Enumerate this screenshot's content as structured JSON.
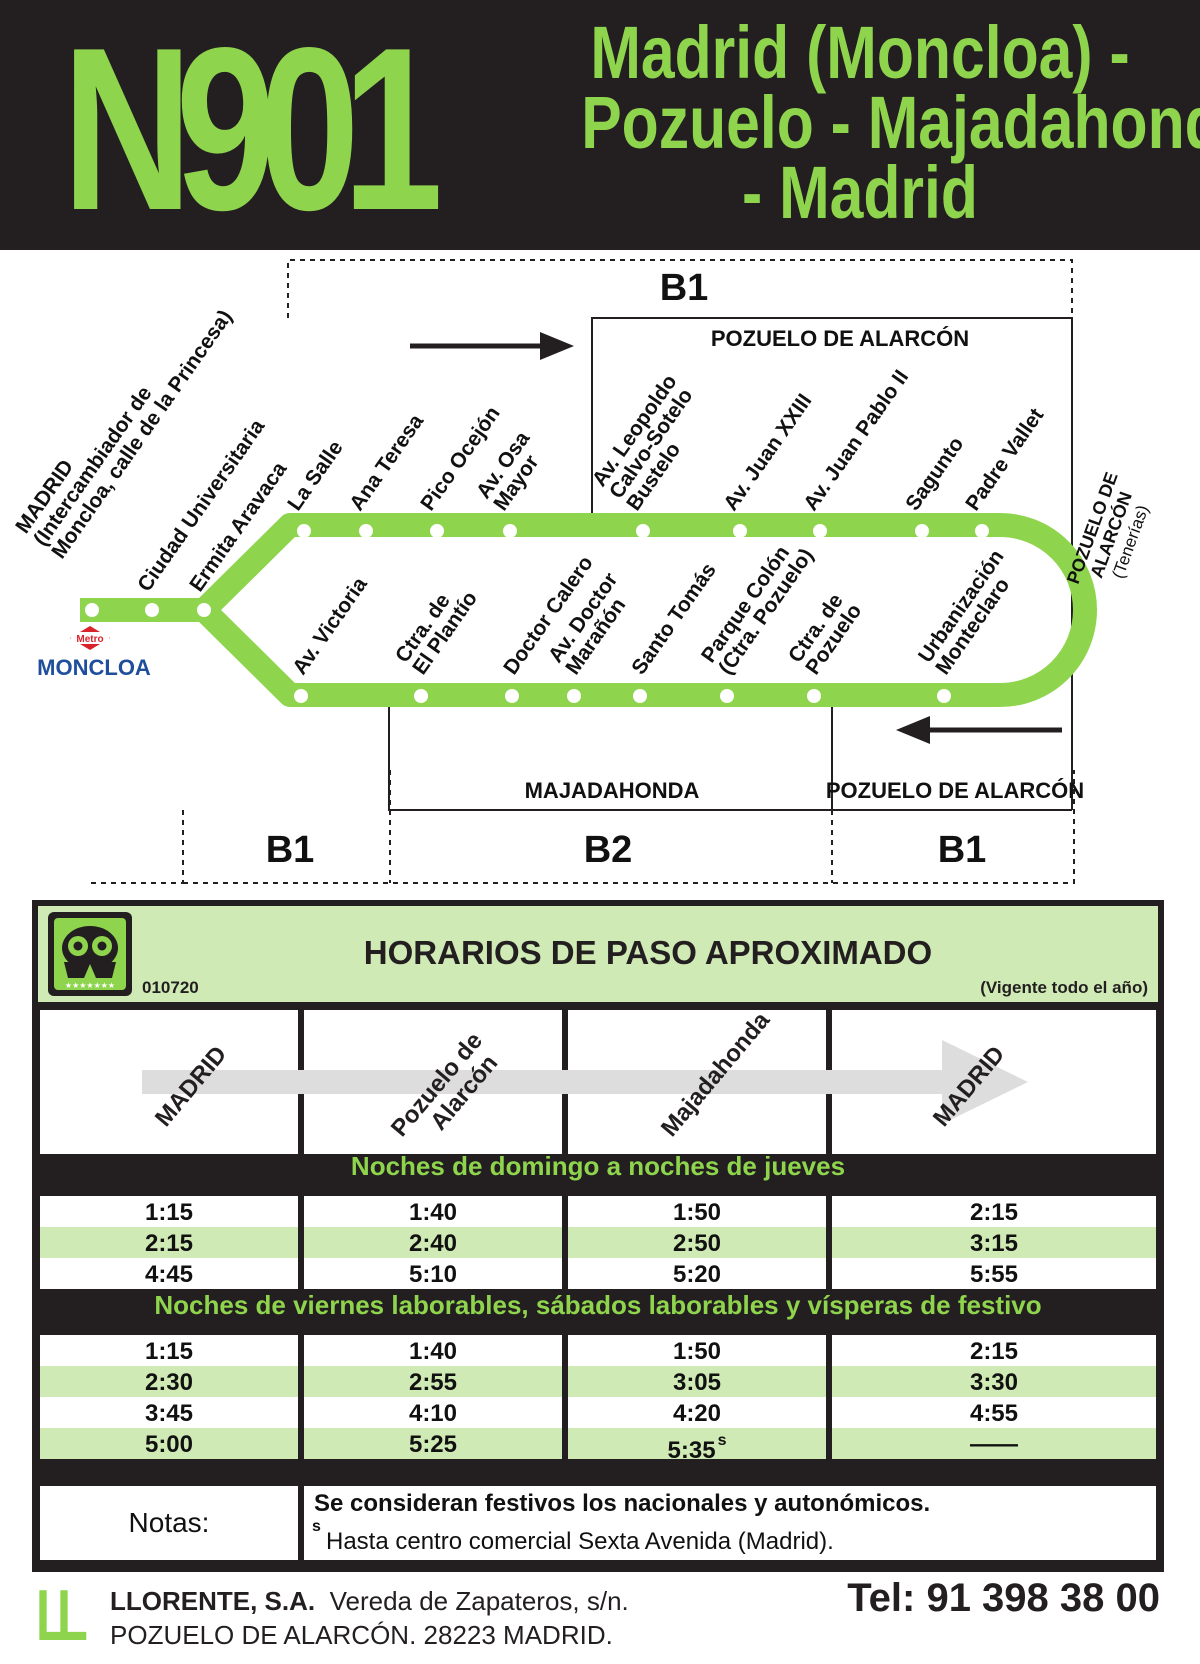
{
  "header": {
    "route_code": "N901",
    "title_lines": [
      "Madrid (Moncloa) -",
      "Pozuelo - Majadahonda",
      "- Madrid"
    ]
  },
  "map": {
    "fare_zones": {
      "top": "B1",
      "bottom_left": "B1",
      "bottom_mid": "B2",
      "bottom_right": "B1"
    },
    "municipalities": {
      "pozuelo_top": "POZUELO DE ALARCÓN",
      "majadahonda": "MAJADAHONDA",
      "pozuelo_bottom": "POZUELO DE ALARCÓN"
    },
    "metro_badge": "Metro",
    "metro_station": "MONCLOA",
    "origin_stop_lines": [
      "MADRID",
      "(Intercambiador de",
      "Moncloa, calle de la Princesa)"
    ],
    "shared_stops": [
      {
        "lines": [
          "Ciudad Universitaria"
        ]
      },
      {
        "lines": [
          "Ermita Aravaca"
        ]
      }
    ],
    "outbound_stops": [
      {
        "lines": [
          "La Salle"
        ]
      },
      {
        "lines": [
          "Ana Teresa"
        ]
      },
      {
        "lines": [
          "Pico Ocejón"
        ]
      },
      {
        "lines": [
          "Av. Osa",
          "Mayor"
        ]
      },
      {
        "lines": [
          "Av. Leopoldo",
          "Calvo-Sotelo",
          "Bustelo"
        ]
      },
      {
        "lines": [
          "Av. Juan XXIII"
        ]
      },
      {
        "lines": [
          "Av. Juan Pablo II"
        ]
      },
      {
        "lines": [
          "Sagunto"
        ]
      },
      {
        "lines": [
          "Padre Vallet"
        ]
      }
    ],
    "terminal_stop_lines": [
      "POZUELO DE",
      "ALARCÓN",
      "(Tenerías)"
    ],
    "return_stops": [
      {
        "lines": [
          "Av. Victoria"
        ]
      },
      {
        "lines": [
          "Ctra. de",
          "El Plantío"
        ]
      },
      {
        "lines": [
          "Doctor Calero"
        ]
      },
      {
        "lines": [
          "Av. Doctor",
          "Marañón"
        ]
      },
      {
        "lines": [
          "Santo Tomás"
        ]
      },
      {
        "lines": [
          "Parque Colón",
          "(Ctra. Pozuelo)"
        ]
      },
      {
        "lines": [
          "Ctra. de",
          "Pozuelo"
        ]
      },
      {
        "lines": [
          "Urbanización",
          "Monteclaro"
        ]
      }
    ],
    "colors": {
      "route": "#8ed44d",
      "dark": "#231f20",
      "metro_red": "#d8232a",
      "metro_blue": "#1f4e9c"
    }
  },
  "timetable": {
    "title": "HORARIOS DE PASO APROXIMADO",
    "code": "010720",
    "validity": "(Vigente todo el año)",
    "columns": [
      "MADRID",
      "Pozuelo de Alarcón",
      "Majadahonda",
      "MADRID"
    ],
    "sections": [
      {
        "title": "Noches de domingo a noches de jueves",
        "rows": [
          [
            "1:15",
            "1:40",
            "1:50",
            "2:15"
          ],
          [
            "2:15",
            "2:40",
            "2:50",
            "3:15"
          ],
          [
            "4:45",
            "5:10",
            "5:20",
            "5:55"
          ]
        ]
      },
      {
        "title": "Noches de viernes laborables, sábados laborables y vísperas de festivo",
        "rows": [
          [
            "1:15",
            "1:40",
            "1:50",
            "2:15"
          ],
          [
            "2:30",
            "2:55",
            "3:05",
            "3:30"
          ],
          [
            "3:45",
            "4:10",
            "4:20",
            "4:55"
          ],
          [
            "5:00",
            "5:25",
            "5:35",
            "——"
          ]
        ]
      }
    ],
    "footnote_mark": "s",
    "notes_label": "Notas:",
    "notes": [
      "Se consideran festivos los nacionales y autonómicos.",
      "Hasta centro comercial Sexta Avenida (Madrid)."
    ]
  },
  "footer": {
    "logo": "LL",
    "company": "LLORENTE, S.A.",
    "address": "Vereda de Zapateros, s/n.",
    "city": "POZUELO DE ALARCÓN. 28223 MADRID.",
    "phone": "Tel: 91 398 38 00"
  }
}
